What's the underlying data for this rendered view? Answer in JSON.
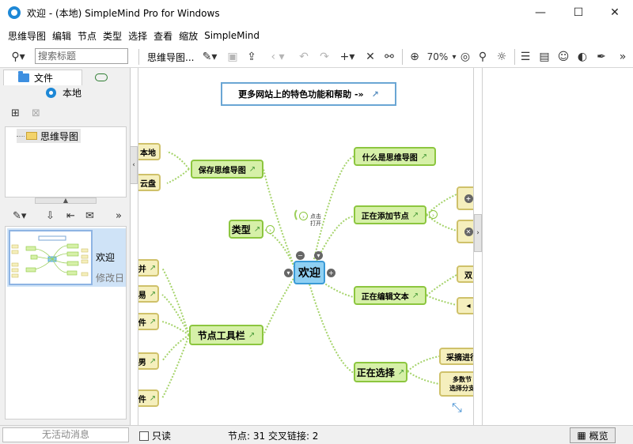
{
  "window": {
    "title": "欢迎 - (本地) SimpleMind Pro for Windows",
    "minimize": "—",
    "maximize": "☐",
    "close": "✕"
  },
  "menu": [
    "思维导图",
    "编辑",
    "节点",
    "类型",
    "选择",
    "查看",
    "缩放",
    "SimpleMind"
  ],
  "toolbar": {
    "search_placeholder": "搜索标题",
    "document_label": "思维导图...",
    "zoom": "70%"
  },
  "left_panel": {
    "tab_files": "文件",
    "local_label": "本地",
    "folder_name": "思维导图",
    "document_name": "欢迎",
    "document_date": "修改日"
  },
  "canvas": {
    "promo": "更多网站上的特色功能和帮助 -»",
    "center": "欢迎",
    "nodes": {
      "save_map": "保存思维导图",
      "local": "本地",
      "cloud": "云盘",
      "types": "类型",
      "node_toolbar": "节点工具栏",
      "what_is": "什么是思维导图",
      "add_node": "正在添加节点",
      "edit_text": "正在编辑文本",
      "selecting": "正在选择",
      "sub_select_1": "采摘进行",
      "sub_select_2a": "多数节",
      "sub_select_2b": "选择分支",
      "tap_open_a": "点击",
      "tap_open_b": "打开",
      "partial_1": "并",
      "partial_2": "易",
      "partial_3": "件",
      "partial_4": "男",
      "partial_5": "件",
      "right_partial": "双"
    }
  },
  "status": {
    "message": "无活动消息",
    "readonly": "只读",
    "counts": "节点: 31 交叉链接: 2",
    "overview": "概览"
  }
}
